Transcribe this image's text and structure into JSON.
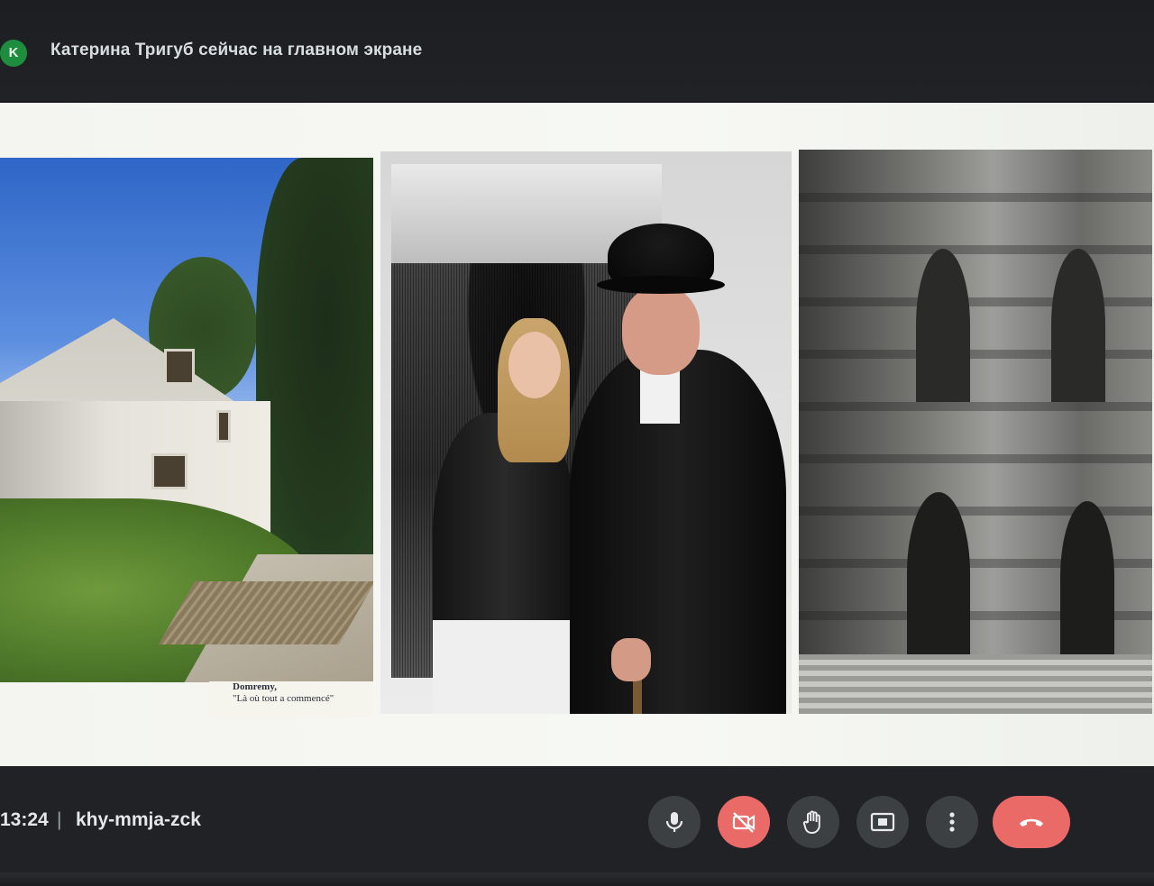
{
  "banner": {
    "avatar_letter": "K",
    "text": "Катерина Тригуб сейчас на главном экране"
  },
  "slide": {
    "caption_line1": "Domremy,",
    "caption_line2": "\"Là où tout a commencé\""
  },
  "meeting": {
    "time": "13:24",
    "separator": "|",
    "code": "khy-mmja-zck"
  },
  "controls": [
    {
      "name": "microphone",
      "icon": "mic-icon",
      "state": "on"
    },
    {
      "name": "camera",
      "icon": "camera-off-icon",
      "state": "off"
    },
    {
      "name": "raise-hand",
      "icon": "hand-icon"
    },
    {
      "name": "present",
      "icon": "present-screen-icon"
    },
    {
      "name": "more-options",
      "icon": "more-vert-icon"
    },
    {
      "name": "leave-call",
      "icon": "call-end-icon"
    }
  ],
  "colors": {
    "avatar_bg": "#1e8e3e",
    "control_bg": "#3c4043",
    "control_red": "#e96a66",
    "bar_bg": "#202226"
  }
}
